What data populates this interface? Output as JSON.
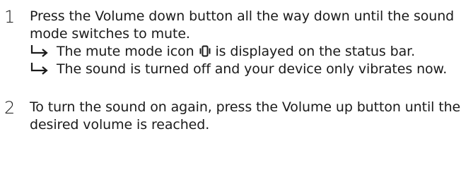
{
  "steps": [
    {
      "number": "1",
      "text": "Press the Volume down button all the way down until the sound mode switches to mute.",
      "results": [
        {
          "before_icon": "The mute mode icon ",
          "icon": "vibrate-icon",
          "after_icon": " is displayed on the status bar."
        },
        {
          "text": "The sound is turned off and your device only vibrates now."
        }
      ]
    },
    {
      "number": "2",
      "text": "To turn the sound on again, press the Volume up button until the desired volume is reached."
    }
  ]
}
